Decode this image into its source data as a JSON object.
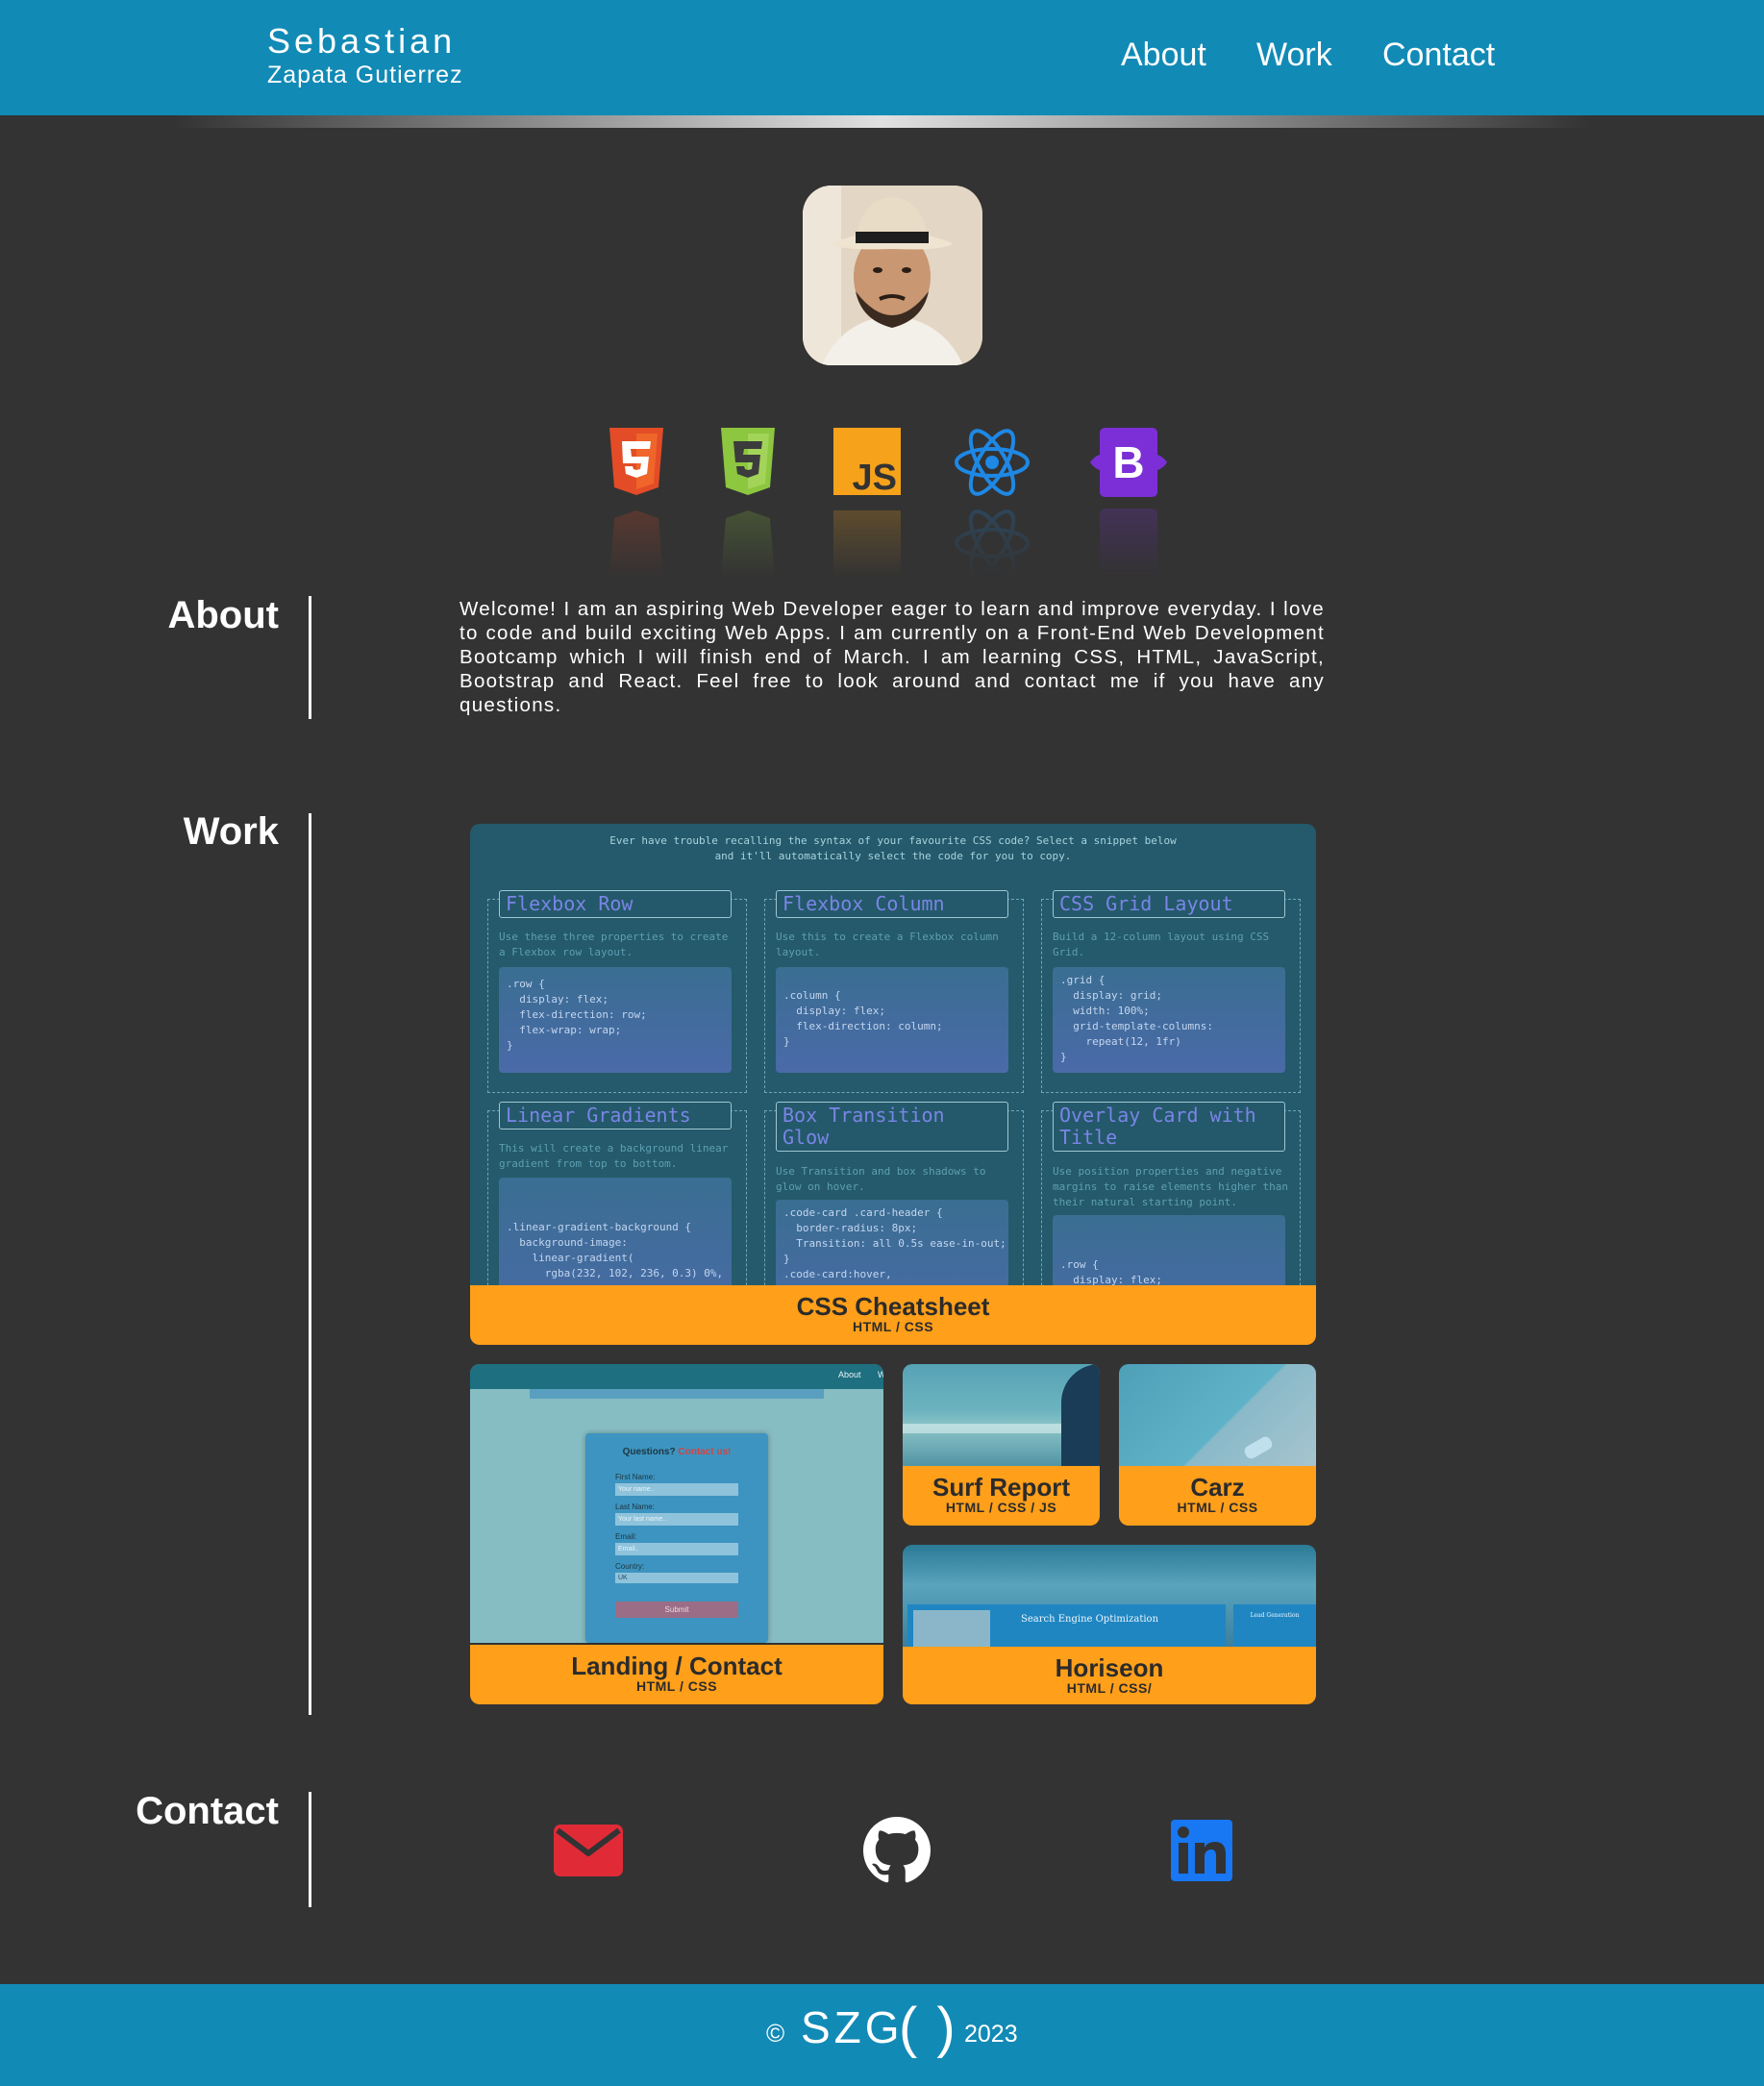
{
  "header": {
    "name": "Sebastian",
    "surname": "Zapata Gutierrez",
    "nav": [
      "About",
      "Work",
      "Contact"
    ]
  },
  "tech_icons": [
    "html5-icon",
    "css3-icon",
    "javascript-icon",
    "react-icon",
    "bootstrap-icon"
  ],
  "about": {
    "title": "About",
    "text": "Welcome! I am an aspiring Web Developer eager to learn and improve everyday. I love to code and build exciting Web Apps. I am currently on a Front-End Web Development Bootcamp which I will finish end of March. I am learning CSS, HTML, JavaScript, Bootstrap and React. Feel free to look around and contact me if you have any questions."
  },
  "work": {
    "title": "Work",
    "projects": [
      {
        "title": "CSS Cheatsheet",
        "tags": "HTML / CSS"
      },
      {
        "title": "Landing / Contact",
        "tags": "HTML / CSS"
      },
      {
        "title": "Surf Report",
        "tags": "HTML / CSS / JS"
      },
      {
        "title": "Carz",
        "tags": "HTML / CSS"
      },
      {
        "title": "Horiseon",
        "tags": "HTML / CSS/"
      }
    ],
    "cheatsheet_preview": {
      "intro": "Ever have trouble recalling the syntax of your favourite CSS code? Select a snippet below and it'll automatically select the code for you to copy.",
      "cards": [
        {
          "title": "Flexbox Row",
          "desc": "Use these three properties to create a Flexbox row layout.",
          "code": ".row {\n  display: flex;\n  flex-direction: row;\n  flex-wrap: wrap;\n}"
        },
        {
          "title": "Flexbox Column",
          "desc": "Use this to create a Flexbox column layout.",
          "code": ".column {\n  display: flex;\n  flex-direction: column;\n}"
        },
        {
          "title": "CSS Grid Layout",
          "desc": "Build a 12-column layout using CSS Grid.",
          "code": ".grid {\n  display: grid;\n  width: 100%;\n  grid-template-columns:\n    repeat(12, 1fr)\n}"
        },
        {
          "title": "Linear Gradients",
          "desc": "This will create a background linear gradient from top to bottom.",
          "code": ".linear-gradient-background {\n  background-image:\n    linear-gradient(\n      rgba(232, 102, 236, 0.3) 0%,"
        },
        {
          "title": "Box Transition Glow",
          "desc": "Use Transition and box shadows to glow on hover.",
          "code": ".code-card .card-header {\n  border-radius: 8px;\n  Transition: all 0.5s ease-in-out;\n}\n.code-card:hover,"
        },
        {
          "title": "Overlay Card with Title",
          "desc": "Use position properties and negative margins to raise elements higher than their natural starting point.",
          "code": ".row {\n  display: flex;"
        }
      ]
    },
    "landing_preview": {
      "nav": "About",
      "heading": "Questions?",
      "heading_link": "Contact us!",
      "first_name_label": "First Name:",
      "first_name_ph": "Your name..",
      "last_name_label": "Last Name:",
      "last_name_ph": "Your last name..",
      "email_label": "Email:",
      "email_ph": "Email..",
      "country_label": "Country:",
      "country_value": "UK",
      "submit": "Submit"
    },
    "horiseon_preview": {
      "seo": "Search Engine Optimization",
      "lead": "Lead Generation"
    }
  },
  "contact": {
    "title": "Contact",
    "icons": [
      "email-icon",
      "github-icon",
      "linkedin-icon"
    ],
    "colors": {
      "email": "#e02b37",
      "github": "#ffffff",
      "linkedin": "#1877f2"
    }
  },
  "footer": {
    "copyright": "©",
    "logo": "SZG",
    "logo_parens": "( )",
    "year": "2023"
  },
  "colors": {
    "header_bg": "#128ab6",
    "page_bg": "#333333",
    "accent": "#ff9f1a"
  }
}
